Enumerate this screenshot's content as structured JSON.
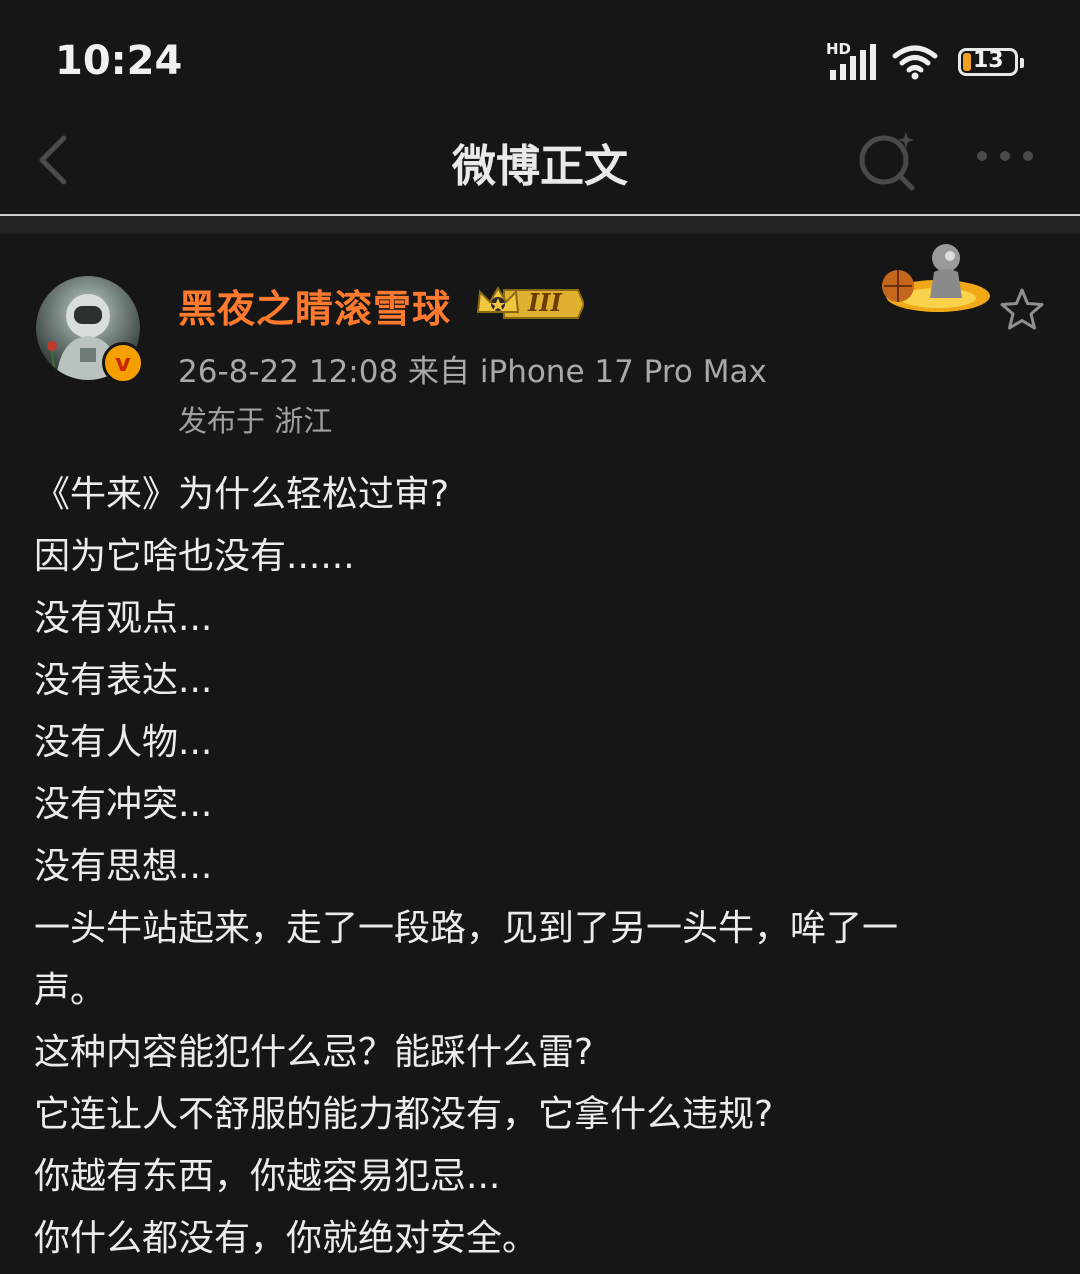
{
  "status_bar": {
    "time": "10:24",
    "network_label": "HD",
    "battery_level": "13",
    "icons": [
      "signal-icon",
      "wifi-icon",
      "battery-icon"
    ]
  },
  "nav": {
    "title": "微博正文",
    "icons": [
      "back-icon",
      "search-icon",
      "more-icon"
    ]
  },
  "post": {
    "username": "黑夜之睛滚雪球",
    "vip_level": "III",
    "verified_mark": "v",
    "meta": "26-8-22 12:08   来自 iPhone 17 Pro Max",
    "location": "发布于 浙江",
    "lines": [
      "《牛来》为什么轻松过审?",
      "因为它啥也没有......",
      "没有观点...",
      "没有表达...",
      "没有人物...",
      "没有冲突...",
      "没有思想...",
      "一头牛站起来，走了一段路，见到了另一头牛，哞了一",
      "声。",
      "这种内容能犯什么忌？能踩什么雷?",
      "它连让人不舒服的能力都没有，它拿什么违规?",
      "你越有东西，你越容易犯忌...",
      "你什么都没有，你就绝对安全。"
    ]
  },
  "colors": {
    "background": "#161616",
    "username": "#ff7a2e",
    "meta_text": "#a9a9a9",
    "body_text": "#ececec",
    "verified_badge": "#f5a000"
  }
}
